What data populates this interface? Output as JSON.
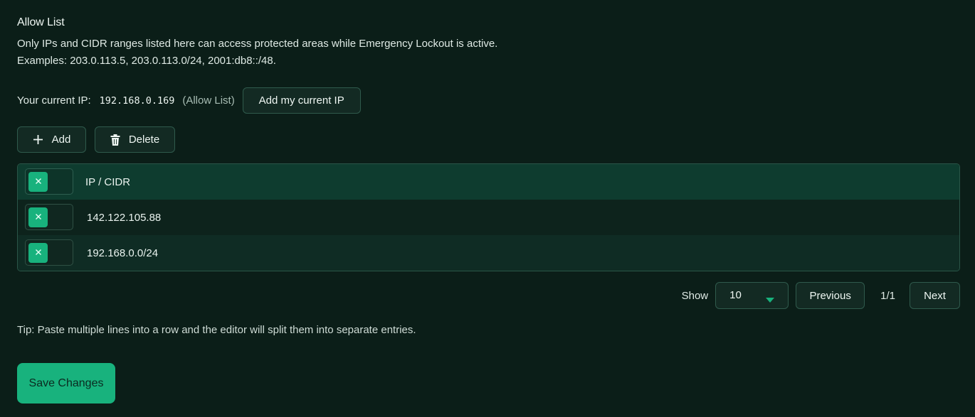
{
  "section": {
    "title": "Allow List",
    "description_line1": "Only IPs and CIDR ranges listed here can access protected areas while Emergency Lockout is active.",
    "description_line2": "Examples: 203.0.113.5, 203.0.113.0/24, 2001:db8::/48."
  },
  "current_ip": {
    "label": "Your current IP:",
    "value": "192.168.0.169",
    "tag": "(Allow List)",
    "add_button_label": "Add my current IP"
  },
  "toolbar": {
    "add_label": "Add",
    "add_icon": "plus-icon",
    "delete_label": "Delete",
    "delete_icon": "trash-icon"
  },
  "table": {
    "header": "IP / CIDR",
    "rows": [
      {
        "value": "142.122.105.88"
      },
      {
        "value": "192.168.0.0/24"
      }
    ],
    "toggle_icon": "close-icon"
  },
  "pagination": {
    "show_label": "Show",
    "page_size": "10",
    "previous_label": "Previous",
    "page_indicator": "1/1",
    "next_label": "Next"
  },
  "tip": "Tip: Paste multiple lines into a row and the editor will split them into separate entries.",
  "save_label": "Save Changes",
  "colors": {
    "background": "#0b1e18",
    "accent": "#18b27d",
    "header_row": "#0e3c2f",
    "border": "#2f5a4c"
  }
}
